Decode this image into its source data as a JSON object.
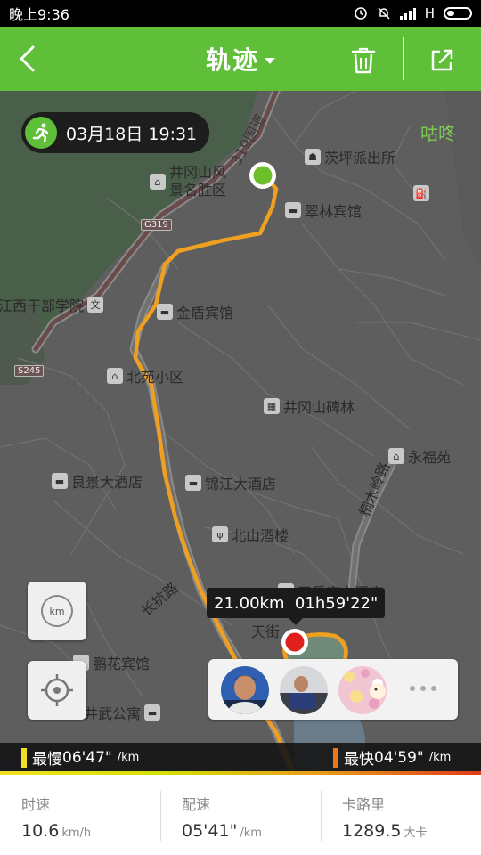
{
  "status_bar": {
    "time": "晚上9:36",
    "network": "H",
    "icons": [
      "alarm-icon",
      "silent-icon",
      "signal-icon",
      "battery-icon"
    ]
  },
  "header": {
    "title": "轨迹",
    "background": "#5fbf38",
    "icons": [
      "back-icon",
      "caret-down-icon",
      "trash-icon",
      "share-icon"
    ]
  },
  "map": {
    "date": "03月18日 19:31",
    "brand": "咕咚",
    "labels": {
      "jinggangshan_scenic_1": "井冈山风",
      "jinggangshan_scenic_2": "景名胜区",
      "maoping_police": "茨坪派出所",
      "cuilin_hotel": "翠林宾馆",
      "jiangxi_cadre": "江西干部学院",
      "jindun_hotel": "金盾宾馆",
      "beiyuan_district": "北苑小区",
      "jgs_monument": "井冈山碑林",
      "yongfu_garden": "永福苑",
      "liangjing_hotel": "良景大酒店",
      "jinjiang_hotel": "锦江大酒店",
      "tongmu_ridge": "桐木岭路",
      "beishan_restaurant": "北山酒楼",
      "changkang_road": "长抗路",
      "tianlefu_hotel": "天乐府大酒店",
      "tianjie": "天街",
      "penghua_hotel": "鹏花宾馆",
      "jingwu_apartment": "井武公寓",
      "road_319": "319国道",
      "sign_g319": "G319",
      "sign_s245": "S245",
      "gaode_logo": "高"
    },
    "track_stats": "21.00km  01h59'22\"",
    "track_color": "#f0a020",
    "start_color": "#6cbf2a",
    "end_color": "#e0201c",
    "controls": {
      "km_label": "km"
    },
    "friends": [
      "avatar-man-red",
      "avatar-man-car",
      "avatar-cartoon-pink"
    ],
    "pace": {
      "slow_label": "最慢",
      "slow_value": "06'47\"",
      "fast_label": "最快",
      "fast_value": "04'59\"",
      "unit": "/km",
      "slow_color": "#f2e022",
      "fast_color": "#e8781a"
    }
  },
  "stats": [
    {
      "label": "时速",
      "value": "10.6",
      "unit": "km/h"
    },
    {
      "label": "配速",
      "value": "05'41\"",
      "unit": "/km"
    },
    {
      "label": "卡路里",
      "value": "1289.5",
      "unit": "大卡"
    }
  ]
}
